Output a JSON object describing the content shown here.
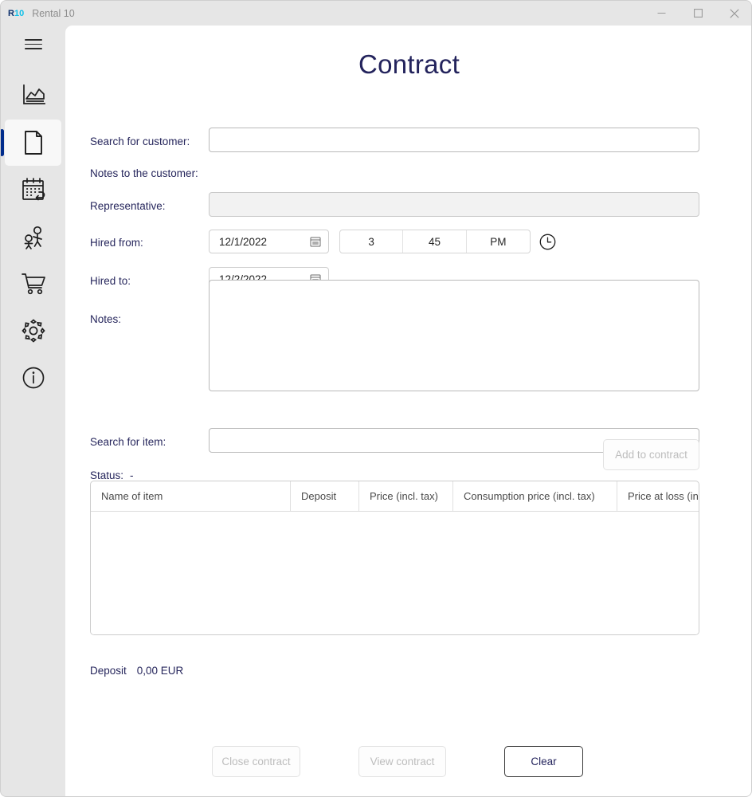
{
  "window": {
    "logo_r": "R",
    "logo_num": "10",
    "title": "Rental 10",
    "minimize_icon": "minimize-icon",
    "maximize_icon": "maximize-icon",
    "close_icon": "close-icon"
  },
  "sidebar": {
    "menu_icon": "hamburger-menu-icon",
    "items": [
      {
        "name": "statistics",
        "icon": "chart-icon",
        "selected": false
      },
      {
        "name": "contract",
        "icon": "document-icon",
        "selected": true
      },
      {
        "name": "returns",
        "icon": "calendar-return-icon",
        "selected": false
      },
      {
        "name": "customers",
        "icon": "people-icon",
        "selected": false
      },
      {
        "name": "items",
        "icon": "shopping-cart-icon",
        "selected": false
      },
      {
        "name": "settings",
        "icon": "gear-icon",
        "selected": false
      },
      {
        "name": "about",
        "icon": "info-icon",
        "selected": false
      }
    ]
  },
  "page": {
    "title": "Contract",
    "labels": {
      "search_customer": "Search for customer:",
      "notes_to_customer": "Notes to the customer:",
      "representative": "Representative:",
      "hired_from": "Hired from:",
      "hired_to": "Hired to:",
      "notes": "Notes:",
      "search_item": "Search for item:",
      "status": "Status:",
      "deposit": "Deposit"
    },
    "fields": {
      "search_customer_value": "",
      "search_customer_placeholder": "",
      "representative_value": "",
      "representative_placeholder": "",
      "hired_from_date": "12/1/2022",
      "hired_to_date": "12/2/2022",
      "time_hour": "3",
      "time_minute": "45",
      "time_meridiem": "PM",
      "notes_value": "",
      "notes_placeholder": "",
      "search_item_value": "",
      "search_item_placeholder": ""
    },
    "status_value": "-",
    "deposit_value": "0,00 EUR",
    "icons": {
      "calendar_from": "calendar-icon",
      "calendar_to": "calendar-icon",
      "clock": "clock-icon"
    },
    "buttons": {
      "add_to_contract": "Add to contract",
      "close_contract": "Close contract",
      "view_contract": "View contract",
      "clear": "Clear"
    },
    "table": {
      "columns": [
        "Name of item",
        "Deposit",
        "Price (incl. tax)",
        "Consumption price (incl. tax)",
        "Price at loss (incl. t"
      ],
      "rows": []
    }
  },
  "colors": {
    "accent": "#002c8c",
    "title_text": "#23235c",
    "label_text": "#26265c",
    "logo_cyan": "#12c0e8",
    "chrome_bg": "#e6e6e6"
  }
}
